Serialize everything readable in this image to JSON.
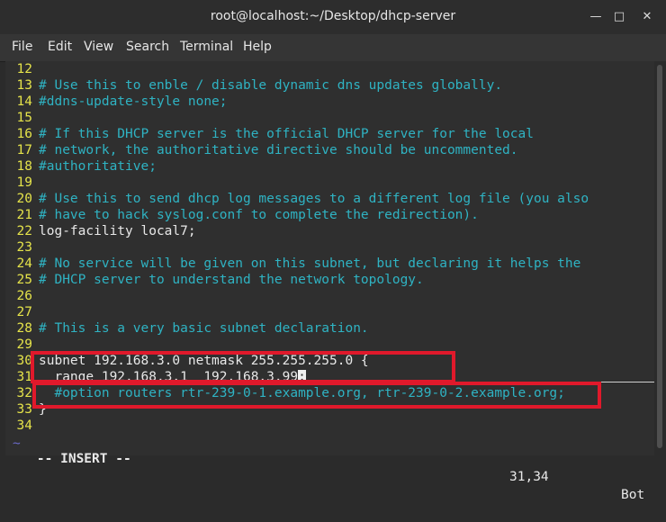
{
  "window": {
    "title": "root@localhost:~/Desktop/dhcp-server",
    "buttons": [
      "minimize-icon",
      "maximize-icon",
      "close-icon"
    ]
  },
  "menu": [
    "File",
    "Edit",
    "View",
    "Search",
    "Terminal",
    "Help"
  ],
  "editor": {
    "lines": [
      {
        "n": "12",
        "text": "",
        "type": "plain"
      },
      {
        "n": "13",
        "text": "# Use this to enble / disable dynamic dns updates globally.",
        "type": "comment"
      },
      {
        "n": "14",
        "text": "#ddns-update-style none;",
        "type": "comment"
      },
      {
        "n": "15",
        "text": "",
        "type": "plain"
      },
      {
        "n": "16",
        "text": "# If this DHCP server is the official DHCP server for the local",
        "type": "comment"
      },
      {
        "n": "17",
        "text": "# network, the authoritative directive should be uncommented.",
        "type": "comment"
      },
      {
        "n": "18",
        "text": "#authoritative;",
        "type": "comment"
      },
      {
        "n": "19",
        "text": "",
        "type": "plain"
      },
      {
        "n": "20",
        "text": "# Use this to send dhcp log messages to a different log file (you also",
        "type": "comment"
      },
      {
        "n": "21",
        "text": "# have to hack syslog.conf to complete the redirection).",
        "type": "comment"
      },
      {
        "n": "22",
        "text": "log-facility local7;",
        "type": "plain"
      },
      {
        "n": "23",
        "text": "",
        "type": "plain"
      },
      {
        "n": "24",
        "text": "# No service will be given on this subnet, but declaring it helps the",
        "type": "comment"
      },
      {
        "n": "25",
        "text": "# DHCP server to understand the network topology.",
        "type": "comment"
      },
      {
        "n": "26",
        "text": "",
        "type": "plain"
      },
      {
        "n": "27",
        "text": "",
        "type": "plain"
      },
      {
        "n": "28",
        "text": "# This is a very basic subnet declaration.",
        "type": "comment"
      },
      {
        "n": "29",
        "text": "",
        "type": "plain"
      },
      {
        "n": "30",
        "text": "subnet 192.168.3.0 netmask 255.255.255.0 {",
        "type": "plain"
      },
      {
        "n": "31",
        "text": "  range 192.168.3.1  192.168.3.99",
        "type": "plain",
        "cursor_char": ";"
      },
      {
        "n": "32",
        "text": "  #option routers rtr-239-0-1.example.org, rtr-239-0-2.example.org;",
        "type": "comment"
      },
      {
        "n": "33",
        "text": "}",
        "type": "plain"
      },
      {
        "n": "34",
        "text": "",
        "type": "plain"
      }
    ],
    "tilde": "~",
    "mode": "-- INSERT --",
    "position": "31,34",
    "scroll": "Bot"
  },
  "colors": {
    "comment": "#2fb3c3",
    "line_number": "#e5e34a",
    "highlight_box": "#e0192b"
  }
}
